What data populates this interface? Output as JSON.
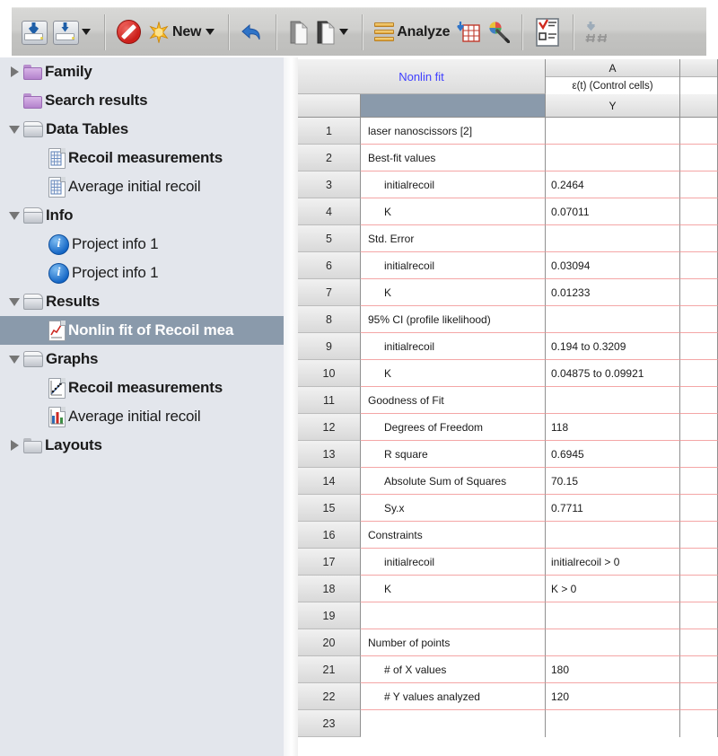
{
  "toolbar": {
    "groups": [
      {
        "name": "file-group",
        "items": [
          {
            "icon": "import-tray-icon",
            "label": "",
            "caret": false
          },
          {
            "icon": "export-tray-icon",
            "label": "",
            "caret": true
          }
        ]
      },
      {
        "name": "new-group",
        "items": [
          {
            "icon": "prohibit-icon",
            "label": "",
            "caret": false
          },
          {
            "icon": "new-star-icon",
            "label": "New",
            "caret": true
          }
        ]
      },
      {
        "name": "undo-group",
        "items": [
          {
            "icon": "undo-arrow-icon",
            "label": "",
            "caret": false
          }
        ]
      },
      {
        "name": "clipboard-group",
        "items": [
          {
            "icon": "copy-page-icon",
            "label": "",
            "caret": false
          },
          {
            "icon": "paste-page-icon",
            "label": "",
            "caret": true
          }
        ]
      },
      {
        "name": "analyze-group",
        "items": [
          {
            "icon": "analyze-bars-icon",
            "label": "Analyze",
            "caret": false
          },
          {
            "icon": "insert-data-table-icon",
            "label": "",
            "caret": false
          },
          {
            "icon": "magic-wand-icon",
            "label": "",
            "caret": false
          }
        ]
      },
      {
        "name": "results-group",
        "items": [
          {
            "icon": "checklist-clipboard-icon",
            "label": "",
            "caret": false
          }
        ]
      },
      {
        "name": "format-group",
        "items": [
          {
            "icon": "hash-number-format-icon",
            "label": "",
            "caret": false
          }
        ]
      }
    ]
  },
  "sidebar": {
    "selected_index": 8,
    "items": [
      {
        "label": "Family",
        "icon": "folder-purple-icon",
        "twisty": "right",
        "indent": 0,
        "bold": true,
        "selected": false
      },
      {
        "label": "Search results",
        "icon": "folder-purple-icon",
        "twisty": "none",
        "indent": 0,
        "bold": true,
        "selected": false
      },
      {
        "label": "Data Tables",
        "icon": "open-folder-icon",
        "twisty": "down",
        "indent": 0,
        "bold": true,
        "selected": false
      },
      {
        "label": "Recoil measurements",
        "icon": "data-table-doc-icon",
        "twisty": "none",
        "indent": 1,
        "bold": true,
        "selected": false
      },
      {
        "label": "Average initial recoil",
        "icon": "data-table-doc-icon",
        "twisty": "none",
        "indent": 1,
        "bold": false,
        "selected": false
      },
      {
        "label": "Info",
        "icon": "open-folder-icon",
        "twisty": "down",
        "indent": 0,
        "bold": true,
        "selected": false
      },
      {
        "label": "Project info 1",
        "icon": "info-circle-icon",
        "twisty": "none",
        "indent": 1,
        "bold": false,
        "selected": false
      },
      {
        "label": "Project info 1",
        "icon": "info-circle-icon",
        "twisty": "none",
        "indent": 1,
        "bold": false,
        "selected": false
      },
      {
        "label": "Results",
        "icon": "open-folder-icon",
        "twisty": "down",
        "indent": 0,
        "bold": true,
        "selected": false
      },
      {
        "label": "Nonlin fit of Recoil mea",
        "icon": "results-doc-icon",
        "twisty": "none",
        "indent": 1,
        "bold": true,
        "selected": true
      },
      {
        "label": "Graphs",
        "icon": "open-folder-icon",
        "twisty": "down",
        "indent": 0,
        "bold": true,
        "selected": false
      },
      {
        "label": "Recoil measurements",
        "icon": "scatter-graph-icon",
        "twisty": "none",
        "indent": 1,
        "bold": true,
        "selected": false
      },
      {
        "label": "Average initial recoil",
        "icon": "bar-graph-icon",
        "twisty": "none",
        "indent": 1,
        "bold": false,
        "selected": false
      },
      {
        "label": "Layouts",
        "icon": "folder-gray-icon",
        "twisty": "right",
        "indent": 0,
        "bold": true,
        "selected": false
      }
    ]
  },
  "sheet": {
    "title": "Nonlin fit",
    "column_a_letter": "A",
    "column_a_subtitle": "ε(t) (Control cells)",
    "column_a_type": "Y",
    "rows": [
      {
        "n": "1",
        "label": "laser nanoscissors [2]",
        "indent": false,
        "a": ""
      },
      {
        "n": "2",
        "label": "Best-fit values",
        "indent": false,
        "a": ""
      },
      {
        "n": "3",
        "label": "initialrecoil",
        "indent": true,
        "a": "0.2464"
      },
      {
        "n": "4",
        "label": "K",
        "indent": true,
        "a": "0.07011"
      },
      {
        "n": "5",
        "label": "Std. Error",
        "indent": false,
        "a": ""
      },
      {
        "n": "6",
        "label": "initialrecoil",
        "indent": true,
        "a": "0.03094"
      },
      {
        "n": "7",
        "label": "K",
        "indent": true,
        "a": "0.01233"
      },
      {
        "n": "8",
        "label": "95% CI (profile likelihood)",
        "indent": false,
        "a": ""
      },
      {
        "n": "9",
        "label": "initialrecoil",
        "indent": true,
        "a": "0.194 to 0.3209"
      },
      {
        "n": "10",
        "label": "K",
        "indent": true,
        "a": "0.04875 to 0.09921"
      },
      {
        "n": "11",
        "label": "Goodness of Fit",
        "indent": false,
        "a": ""
      },
      {
        "n": "12",
        "label": "Degrees of Freedom",
        "indent": true,
        "a": "118"
      },
      {
        "n": "13",
        "label": "R square",
        "indent": true,
        "a": "0.6945"
      },
      {
        "n": "14",
        "label": "Absolute Sum of Squares",
        "indent": true,
        "a": "70.15"
      },
      {
        "n": "15",
        "label": "Sy.x",
        "indent": true,
        "a": "0.7711"
      },
      {
        "n": "16",
        "label": "Constraints",
        "indent": false,
        "a": ""
      },
      {
        "n": "17",
        "label": "initialrecoil",
        "indent": true,
        "a": "initialrecoil > 0"
      },
      {
        "n": "18",
        "label": "K",
        "indent": true,
        "a": "K > 0"
      },
      {
        "n": "19",
        "label": "",
        "indent": false,
        "a": ""
      },
      {
        "n": "20",
        "label": "Number of points",
        "indent": false,
        "a": ""
      },
      {
        "n": "21",
        "label": "# of X values",
        "indent": true,
        "a": "180"
      },
      {
        "n": "22",
        "label": "# Y values analyzed",
        "indent": true,
        "a": "120"
      },
      {
        "n": "23",
        "label": "",
        "indent": false,
        "a": ""
      }
    ]
  },
  "colors": {
    "selection": "#8a9aab",
    "title_blue": "#4040ff",
    "row_divider_red": "#f4a6a6",
    "sidebar_bg": "#e3e6ec",
    "toolbar_bg": "#cfcfcd"
  }
}
